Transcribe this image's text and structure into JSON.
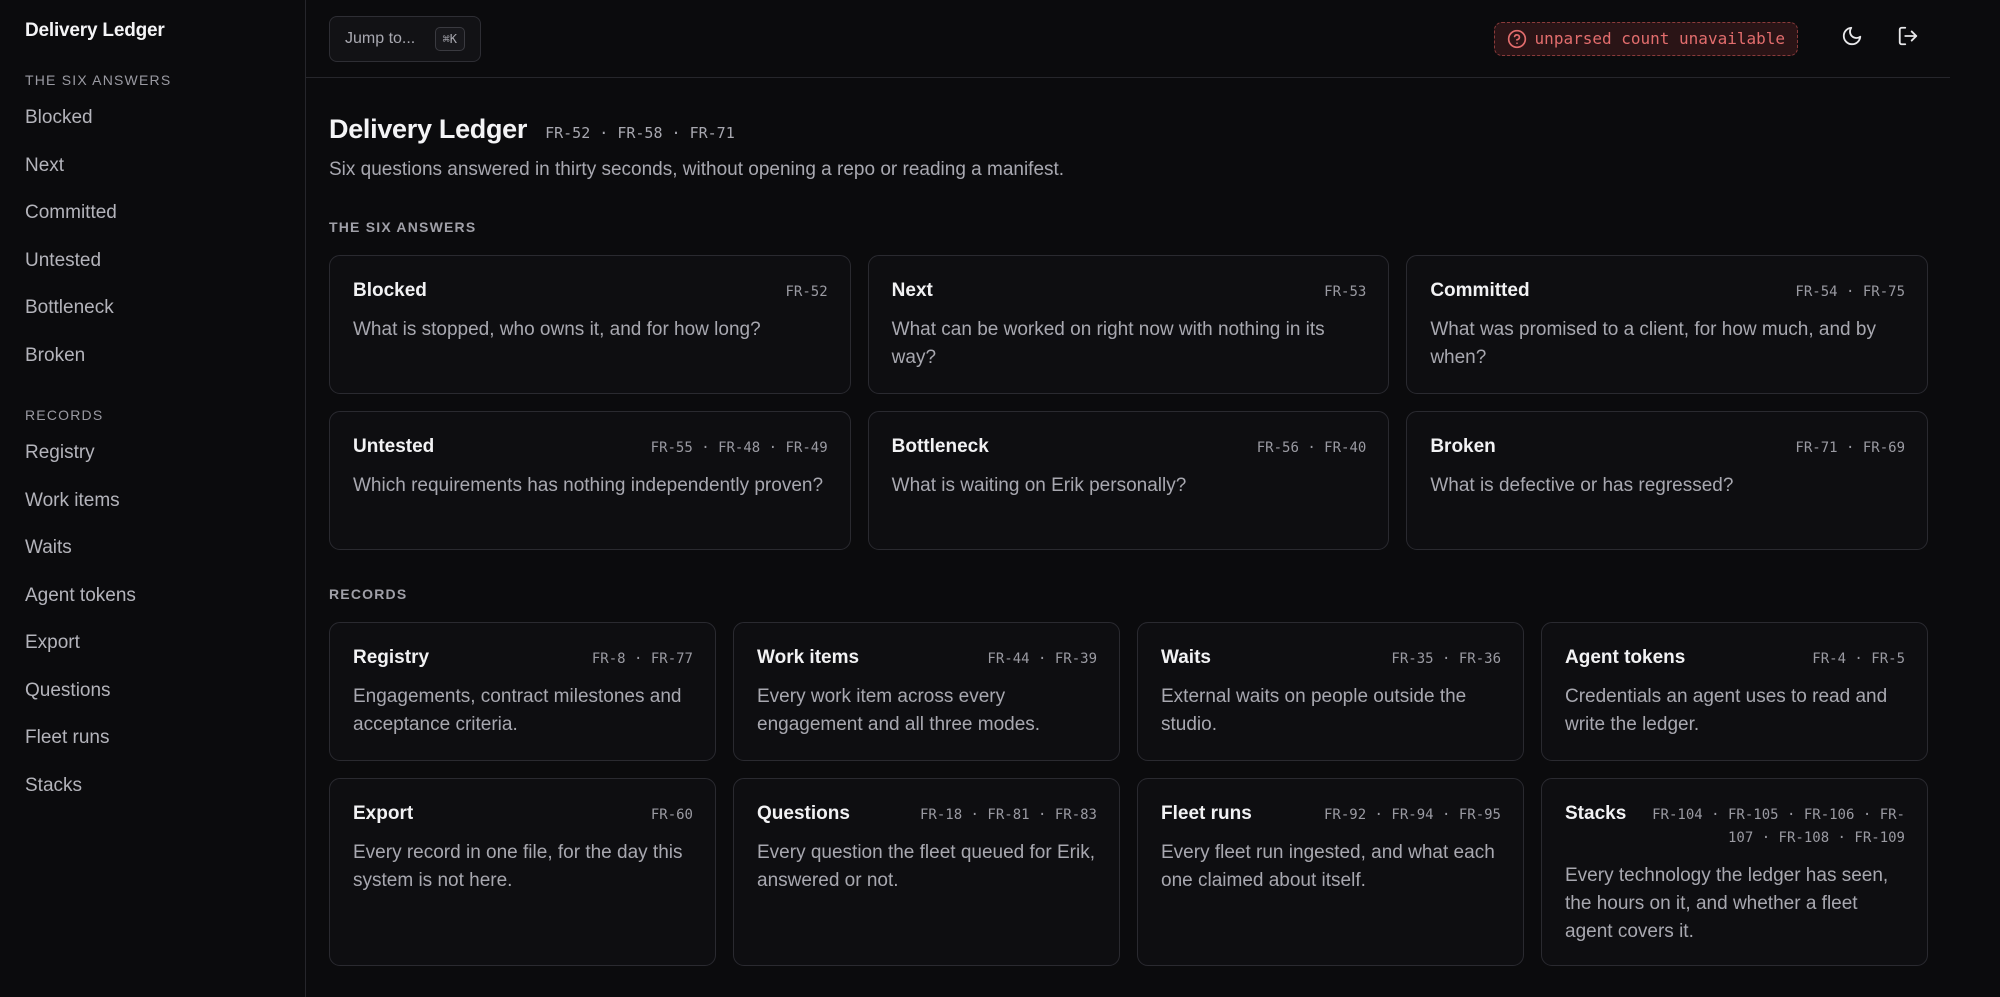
{
  "app": {
    "brand": "Delivery Ledger"
  },
  "sidebar": {
    "section1_title": "THE SIX ANSWERS",
    "answers": [
      "Blocked",
      "Next",
      "Committed",
      "Untested",
      "Bottleneck",
      "Broken"
    ],
    "section2_title": "RECORDS",
    "records": [
      "Registry",
      "Work items",
      "Waits",
      "Agent tokens",
      "Export",
      "Questions",
      "Fleet runs",
      "Stacks"
    ]
  },
  "topbar": {
    "jump_label": "Jump to...",
    "jump_shortcut": "⌘K",
    "warning": "unparsed count unavailable",
    "icons": {
      "warning": "help-circle-icon",
      "theme": "moon-icon",
      "logout": "logout-icon"
    },
    "warning_color": "#e26d6d"
  },
  "page": {
    "title": "Delivery Ledger",
    "refs": "FR-52 · FR-58 · FR-71",
    "subtitle": "Six questions answered in thirty seconds, without opening a repo or reading a manifest."
  },
  "answers_section": {
    "title": "THE SIX ANSWERS",
    "cards": [
      {
        "title": "Blocked",
        "refs": "FR-52",
        "desc": "What is stopped, who owns it, and for how long?"
      },
      {
        "title": "Next",
        "refs": "FR-53",
        "desc": "What can be worked on right now with nothing in its way?"
      },
      {
        "title": "Committed",
        "refs": "FR-54 · FR-75",
        "desc": "What was promised to a client, for how much, and by when?"
      },
      {
        "title": "Untested",
        "refs": "FR-55 · FR-48 · FR-49",
        "desc": "Which requirements has nothing independently proven?"
      },
      {
        "title": "Bottleneck",
        "refs": "FR-56 · FR-40",
        "desc": "What is waiting on Erik personally?"
      },
      {
        "title": "Broken",
        "refs": "FR-71 · FR-69",
        "desc": "What is defective or has regressed?"
      }
    ]
  },
  "records_section": {
    "title": "RECORDS",
    "cards": [
      {
        "title": "Registry",
        "refs": "FR-8 · FR-77",
        "desc": "Engagements, contract milestones and acceptance criteria."
      },
      {
        "title": "Work items",
        "refs": "FR-44 · FR-39",
        "desc": "Every work item across every engagement and all three modes."
      },
      {
        "title": "Waits",
        "refs": "FR-35 · FR-36",
        "desc": "External waits on people outside the studio."
      },
      {
        "title": "Agent tokens",
        "refs": "FR-4 · FR-5",
        "desc": "Credentials an agent uses to read and write the ledger."
      },
      {
        "title": "Export",
        "refs": "FR-60",
        "desc": "Every record in one file, for the day this system is not here."
      },
      {
        "title": "Questions",
        "refs": "FR-18 · FR-81 · FR-83",
        "desc": "Every question the fleet queued for Erik, answered or not."
      },
      {
        "title": "Fleet runs",
        "refs": "FR-92 · FR-94 · FR-95",
        "desc": "Every fleet run ingested, and what each one claimed about itself."
      },
      {
        "title": "Stacks",
        "refs": "FR-104 · FR-105 · FR-106 · FR-107 · FR-108 · FR-109",
        "desc": "Every technology the ledger has seen, the hours on it, and whether a fleet agent covers it."
      }
    ]
  }
}
